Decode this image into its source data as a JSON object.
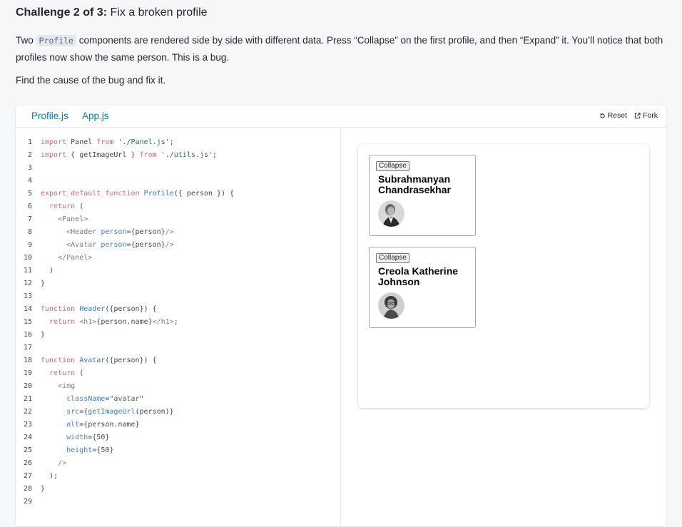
{
  "challenge": {
    "prefix": "Challenge 2 of 3:",
    "title": "Fix a broken profile"
  },
  "description": {
    "part1": "Two ",
    "code": "Profile",
    "part2": " components are rendered side by side with different data. Press “Collapse” on the first profile, and then “Expand” it. You’ll notice that both profiles now show the same person. This is a bug.",
    "find": "Find the cause of the bug and fix it."
  },
  "tabs": [
    "Profile.js",
    "App.js"
  ],
  "actions": {
    "reset": "Reset",
    "fork": "Fork"
  },
  "code_lines": [
    "import Panel from './Panel.js';",
    "import { getImageUrl } from './utils.js';",
    "",
    "",
    "export default function Profile({ person }) {",
    "  return (",
    "    <Panel>",
    "      <Header person={person}/>",
    "      <Avatar person={person}/>",
    "    </Panel>",
    "  )",
    "}",
    "",
    "function Header({person}) {",
    "  return <h1>{person.name}</h1>;",
    "}",
    "",
    "function Avatar({person}) {",
    "  return (",
    "    <img",
    "      className=\"avatar\"",
    "      src={getImageUrl(person)}",
    "      alt={person.name}",
    "      width={50}",
    "      height={50}",
    "    />",
    "  );",
    "}",
    ""
  ],
  "profiles": [
    {
      "button": "Collapse",
      "name": "Subrahmanyan Chandrasekhar"
    },
    {
      "button": "Collapse",
      "name": "Creola Katherine Johnson"
    }
  ]
}
